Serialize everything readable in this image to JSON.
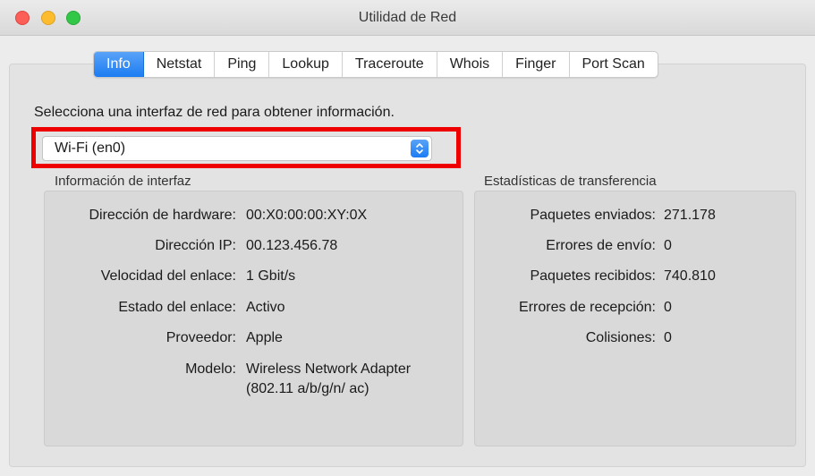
{
  "window": {
    "title": "Utilidad de Red"
  },
  "tabs": [
    {
      "label": "Info",
      "active": true
    },
    {
      "label": "Netstat",
      "active": false
    },
    {
      "label": "Ping",
      "active": false
    },
    {
      "label": "Lookup",
      "active": false
    },
    {
      "label": "Traceroute",
      "active": false
    },
    {
      "label": "Whois",
      "active": false
    },
    {
      "label": "Finger",
      "active": false
    },
    {
      "label": "Port Scan",
      "active": false
    }
  ],
  "info": {
    "prompt": "Selecciona una interfaz de red para obtener información.",
    "interface_select": {
      "value": "Wi-Fi (en0)"
    },
    "interface_info": {
      "label": "Información de interfaz",
      "rows": [
        {
          "key": "Dirección de hardware:",
          "value": "00:X0:00:00:XY:0X"
        },
        {
          "key": "Dirección IP:",
          "value": "00.123.456.78"
        },
        {
          "key": "Velocidad del enlace:",
          "value": "1 Gbit/s"
        },
        {
          "key": "Estado del enlace:",
          "value": "Activo"
        },
        {
          "key": "Proveedor:",
          "value": "Apple"
        },
        {
          "key": "Modelo:",
          "value": "Wireless Network Adapter (802.11 a/b/g/n/ ac)"
        }
      ]
    },
    "transfer_stats": {
      "label": "Estadísticas de transferencia",
      "rows": [
        {
          "key": "Paquetes enviados:",
          "value": "271.178"
        },
        {
          "key": "Errores de envío:",
          "value": "0"
        },
        {
          "key": "Paquetes recibidos:",
          "value": "740.810"
        },
        {
          "key": "Errores de recepción:",
          "value": "0"
        },
        {
          "key": "Colisiones:",
          "value": "0"
        }
      ]
    }
  },
  "colors": {
    "accent": "#1b7cf2",
    "highlight": "#ee0000"
  }
}
